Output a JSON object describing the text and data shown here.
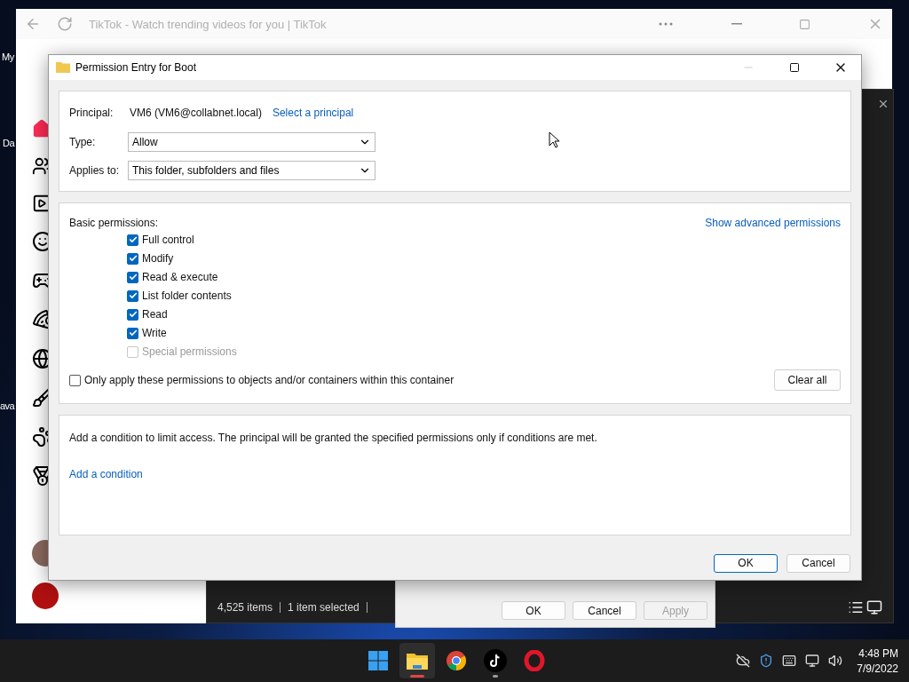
{
  "desktop_icons": [
    {
      "label": "My"
    },
    {
      "label": "Da"
    },
    {
      "label": "ava"
    }
  ],
  "browser": {
    "title": "TikTok - Watch trending videos for you | TikTok"
  },
  "explorer": {
    "status_items": [
      "4,525 items",
      "1 item selected"
    ]
  },
  "properties_dialog": {
    "buttons": [
      {
        "label": "OK",
        "disabled": false
      },
      {
        "label": "Cancel",
        "disabled": false
      },
      {
        "label": "Apply",
        "disabled": true
      }
    ]
  },
  "dialog": {
    "title": "Permission Entry for Boot",
    "principal": {
      "label": "Principal:",
      "value": "VM6 (VM6@collabnet.local)",
      "link": "Select a principal"
    },
    "type": {
      "label": "Type:",
      "value": "Allow"
    },
    "applies_to": {
      "label": "Applies to:",
      "value": "This folder, subfolders and files"
    },
    "basic_permissions": {
      "label": "Basic permissions:",
      "link": "Show advanced permissions"
    },
    "permissions": [
      {
        "label": "Full control",
        "checked": true,
        "disabled": false
      },
      {
        "label": "Modify",
        "checked": true,
        "disabled": false
      },
      {
        "label": "Read & execute",
        "checked": true,
        "disabled": false
      },
      {
        "label": "List folder contents",
        "checked": true,
        "disabled": false
      },
      {
        "label": "Read",
        "checked": true,
        "disabled": false
      },
      {
        "label": "Write",
        "checked": true,
        "disabled": false
      },
      {
        "label": "Special permissions",
        "checked": false,
        "disabled": true
      }
    ],
    "only_apply": {
      "label": "Only apply these permissions to objects and/or containers within this container",
      "checked": false
    },
    "clear_all": "Clear all",
    "condition_text": "Add a condition to limit access. The principal will be granted the specified permissions only if conditions are met.",
    "add_condition": "Add a condition",
    "buttons": [
      {
        "label": "OK",
        "default": true
      },
      {
        "label": "Cancel",
        "default": false
      }
    ]
  },
  "taskbar": {
    "apps": [
      {
        "kind": "start",
        "open": false,
        "focused": false
      },
      {
        "kind": "folder",
        "open": true,
        "focused": true
      },
      {
        "kind": "chrome",
        "open": false,
        "focused": false
      },
      {
        "kind": "tiktok",
        "open": true,
        "focused": false
      },
      {
        "kind": "opera",
        "open": false,
        "focused": false
      }
    ],
    "time": "4:48 PM",
    "date": "7/9/2022"
  }
}
